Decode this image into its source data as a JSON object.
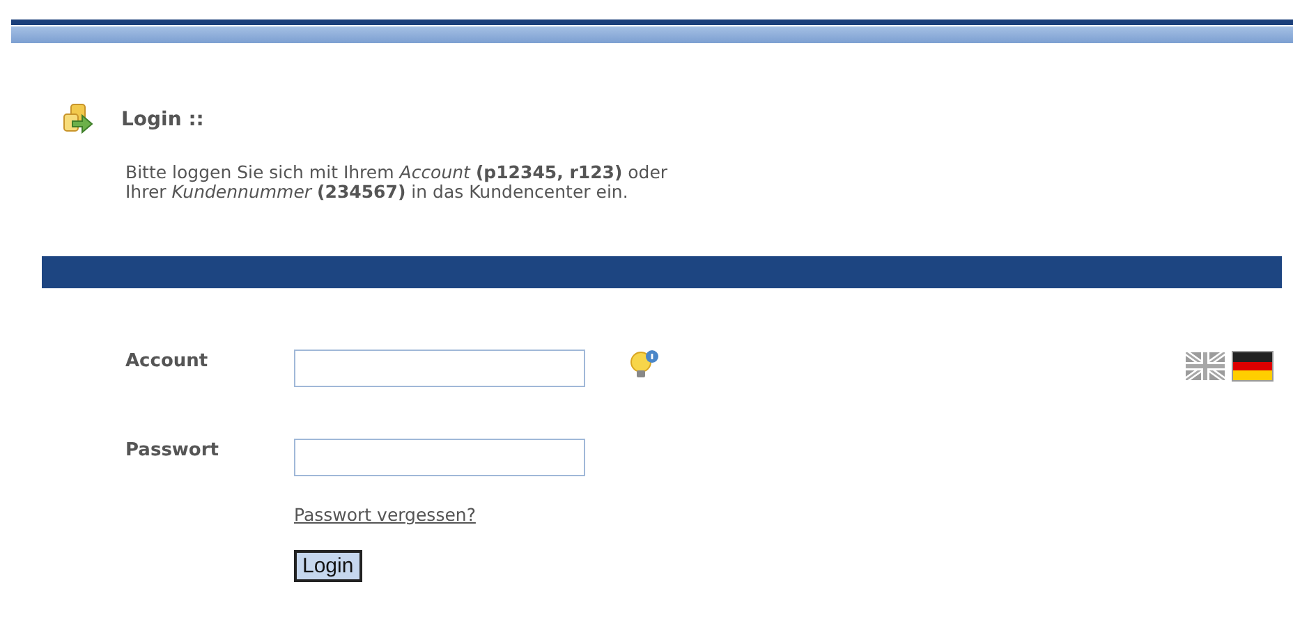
{
  "heading": "Login ::",
  "intro": [
    "Bitte loggen Sie sich mit Ihrem *Account* **(p12345, r123)** oder",
    "Ihrer *Kundennummer* **(234567)** in das Kundencenter ein."
  ],
  "fields": [
    {
      "label": "Account",
      "hint_icon": true
    },
    {
      "label": "Passwort",
      "hint_icon": false
    }
  ],
  "forgot_link": "Passwort vergessen?",
  "submit": "Login",
  "languages": [
    {
      "kind": "uk",
      "selected": false
    },
    {
      "kind": "germany",
      "selected": true
    }
  ]
}
